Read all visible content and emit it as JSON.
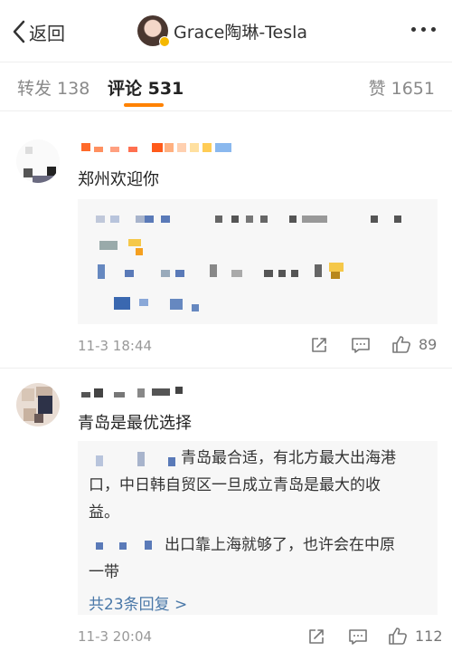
{
  "header": {
    "back_label": "返回",
    "profile_name": "Grace陶琳-Tesla"
  },
  "tabs": {
    "repost": "转发 138",
    "comments": "评论 531",
    "likes": "赞 1651"
  },
  "comments": [
    {
      "text": "郑州欢迎你",
      "time": "11-3 18:44",
      "likes": "89"
    },
    {
      "text": "青岛是最优选择",
      "reply_1": [
        "青岛最合适，有北方最大出海港",
        "口，中日韩自贸区一旦成立青岛是最大的收",
        "益。"
      ],
      "reply_2": [
        "出口靠上海就够了，也许会在中原",
        "一带"
      ],
      "more_replies": "共23条回复 >",
      "time": "11-3 20:04",
      "likes": "112"
    }
  ],
  "colors": {
    "accent": "#ff8200",
    "link": "#4a78a8",
    "verified_badge": "#f5b800"
  },
  "icons": [
    "back-chevron-icon",
    "more-dots-icon",
    "share-icon",
    "comment-icon",
    "like-icon"
  ]
}
